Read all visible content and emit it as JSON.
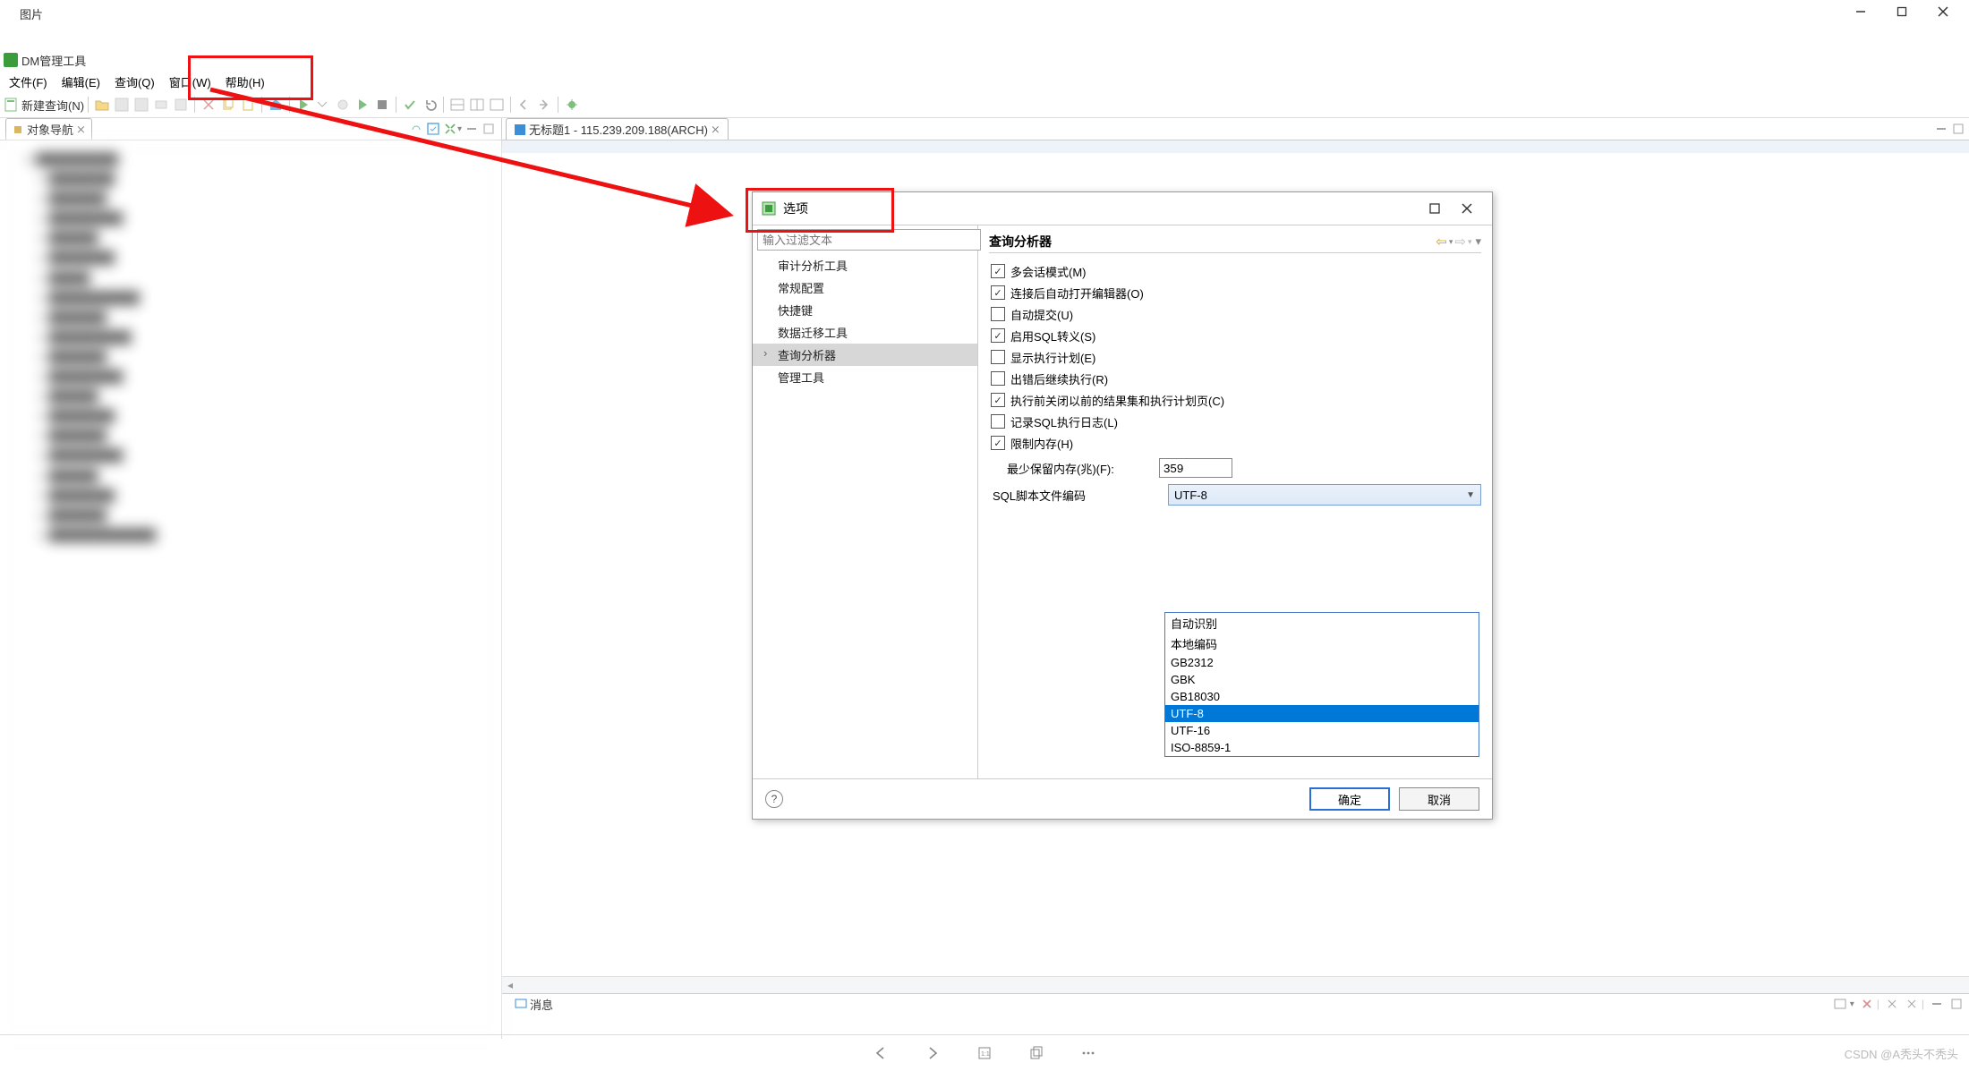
{
  "outer": {
    "title": "图片"
  },
  "app": {
    "title": "DM管理工具"
  },
  "window_controls": {
    "min": "—",
    "max": "□",
    "close": "✕"
  },
  "menus": {
    "file": "文件(F)",
    "edit": "编辑(E)",
    "query": "查询(Q)",
    "window": "窗口(W)",
    "help": "帮助(H)"
  },
  "toolbar": {
    "new_query": "新建查询(N)"
  },
  "panes": {
    "left_title": "对象导航",
    "editor_tab": "无标题1 - 115.239.209.188(ARCH)",
    "messages_tab": "消息"
  },
  "dialog": {
    "title": "选项",
    "filter_placeholder": "输入过滤文本",
    "nav": {
      "audit": "审计分析工具",
      "general": "常规配置",
      "shortcut": "快捷键",
      "migrate": "数据迁移工具",
      "query_analyzer": "查询分析器",
      "admin": "管理工具"
    },
    "section": "查询分析器",
    "opts": {
      "multi_session": "多会话模式(M)",
      "open_editor": "连接后自动打开编辑器(O)",
      "auto_commit": "自动提交(U)",
      "sql_escape": "启用SQL转义(S)",
      "show_plan": "显示执行计划(E)",
      "continue_err": "出错后继续执行(R)",
      "close_prev": "执行前关闭以前的结果集和执行计划页(C)",
      "log_sql": "记录SQL执行日志(L)",
      "limit_mem": "限制内存(H)"
    },
    "mem_label": "最少保留内存(兆)(F):",
    "mem_value": "359",
    "encoding_label": "SQL脚本文件编码",
    "encoding_value": "UTF-8",
    "encoding_options": [
      "自动识别",
      "本地编码",
      "GB2312",
      "GBK",
      "GB18030",
      "UTF-8",
      "UTF-16",
      "ISO-8859-1"
    ],
    "ok": "确定",
    "cancel": "取消"
  },
  "watermark": "CSDN @A秃头不秃头"
}
